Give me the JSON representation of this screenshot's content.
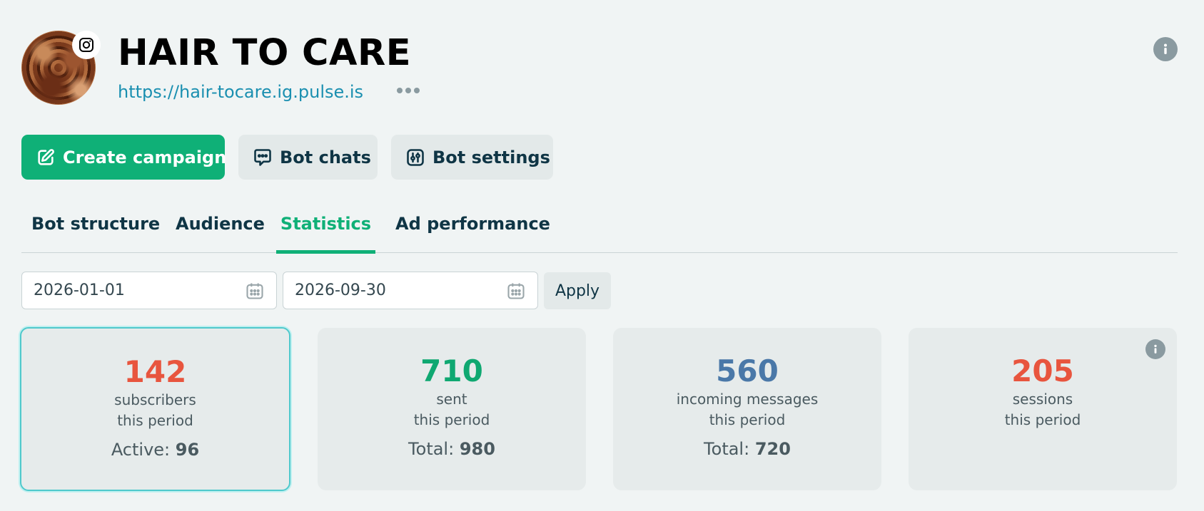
{
  "header": {
    "title": "HAIR TO CARE",
    "link": "https://hair-tocare.ig.pulse.is"
  },
  "actions": {
    "create_campaign": "Create campaign",
    "bot_chats": "Bot chats",
    "bot_settings": "Bot settings"
  },
  "tabs": [
    {
      "label": "Bot structure",
      "active": false
    },
    {
      "label": "Audience",
      "active": false
    },
    {
      "label": "Statistics",
      "active": true
    },
    {
      "label": "Ad performance",
      "active": false
    }
  ],
  "filters": {
    "date_from": "2026-01-01",
    "date_to": "2026-09-30",
    "apply_label": "Apply"
  },
  "stats": [
    {
      "value": "142",
      "label1": "subscribers",
      "label2": "this period",
      "extra_label": "Active:",
      "extra_value": "96",
      "color": "#e8553e"
    },
    {
      "value": "710",
      "label1": "sent",
      "label2": "this period",
      "extra_label": "Total:",
      "extra_value": "980",
      "color": "#0fa871"
    },
    {
      "value": "560",
      "label1": "incoming messages",
      "label2": "this period",
      "extra_label": "Total:",
      "extra_value": "720",
      "color": "#4a78a8"
    },
    {
      "value": "205",
      "label1": "sessions",
      "label2": "this period",
      "color": "#e8553e"
    }
  ],
  "colors": {
    "accent": "#0fb077",
    "link": "#1a8fb0",
    "background": "#f0f4f4"
  },
  "icons": {
    "avatar_badge": "instagram-icon",
    "more": "more-dots-icon",
    "info": "info-icon",
    "create_campaign": "edit-icon",
    "bot_chats": "chat-icon",
    "bot_settings": "sliders-icon",
    "date_picker": "calendar-icon"
  }
}
